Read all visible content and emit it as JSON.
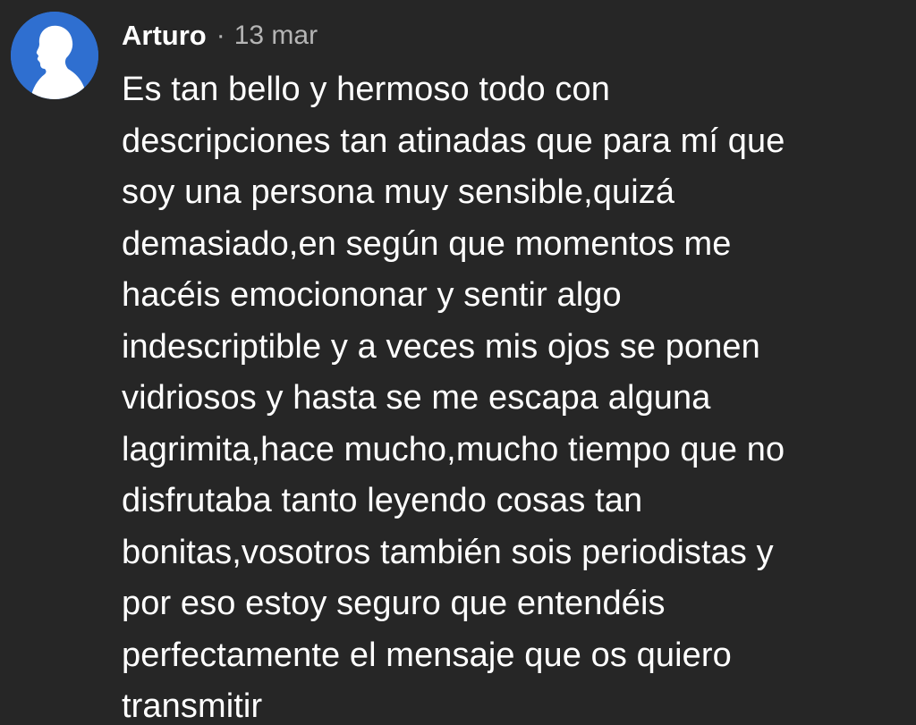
{
  "comment": {
    "author": "Arturo",
    "separator": "·",
    "date": "13 mar",
    "avatar_icon": "person-silhouette-icon",
    "avatar_color": "#2f6fd0",
    "background_color": "#262626",
    "text_lines": [
      "Es tan bello y hermoso todo con",
      "descripciones tan atinadas que para mí que",
      "soy una persona muy sensible,quizá",
      "demasiado,en según que momentos me",
      "hacéis emociononar y sentir algo",
      "indescriptible y a veces mis ojos se ponen",
      "vidriosos y hasta se me escapa alguna",
      "lagrimita,hace mucho,mucho tiempo que no",
      "disfrutaba tanto leyendo cosas tan",
      "bonitas,vosotros también sois periodistas y",
      "por eso estoy seguro que entendéis",
      "perfectamente el mensaje que os quiero",
      "transmitir"
    ]
  }
}
